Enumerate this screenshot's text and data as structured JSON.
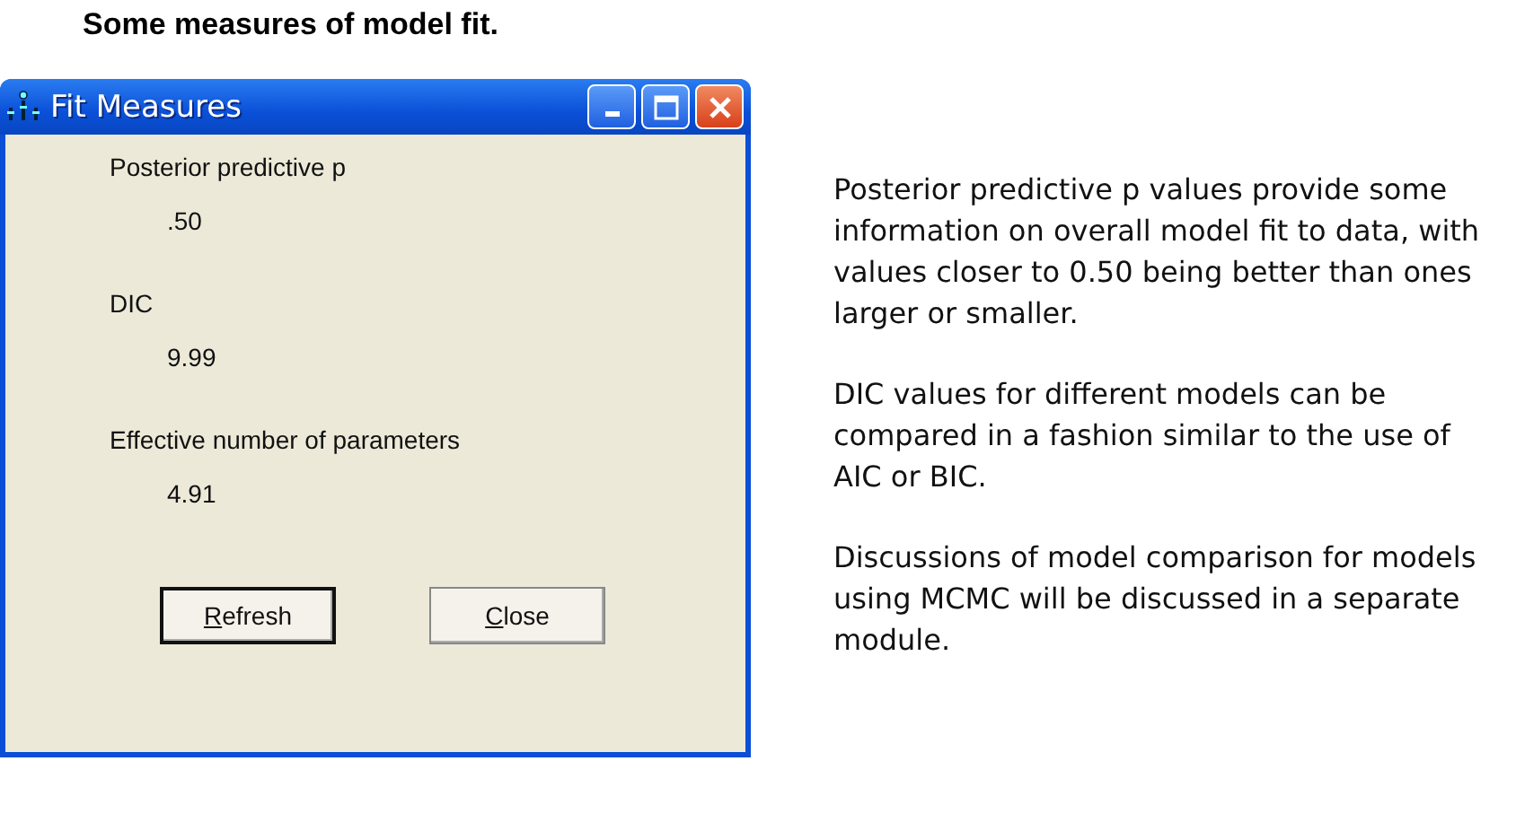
{
  "heading": "Some measures of model fit.",
  "window": {
    "title": "Fit Measures",
    "measures": [
      {
        "label": "Posterior predictive p",
        "value": ".50"
      },
      {
        "label": "DIC",
        "value": "9.99"
      },
      {
        "label": "Effective number of parameters",
        "value": "4.91"
      }
    ],
    "buttons": [
      {
        "label": "Refresh",
        "default": true
      },
      {
        "label": "Close",
        "default": false
      }
    ]
  },
  "notes": [
    "Posterior predictive p values provide some information on overall model fit to data, with values closer to 0.50 being better than ones larger or smaller.",
    "DIC values for different models can be compared in a fashion similar to the use of AIC or BIC.",
    "Discussions of model comparison for models using MCMC will be discussed in a separate module."
  ]
}
